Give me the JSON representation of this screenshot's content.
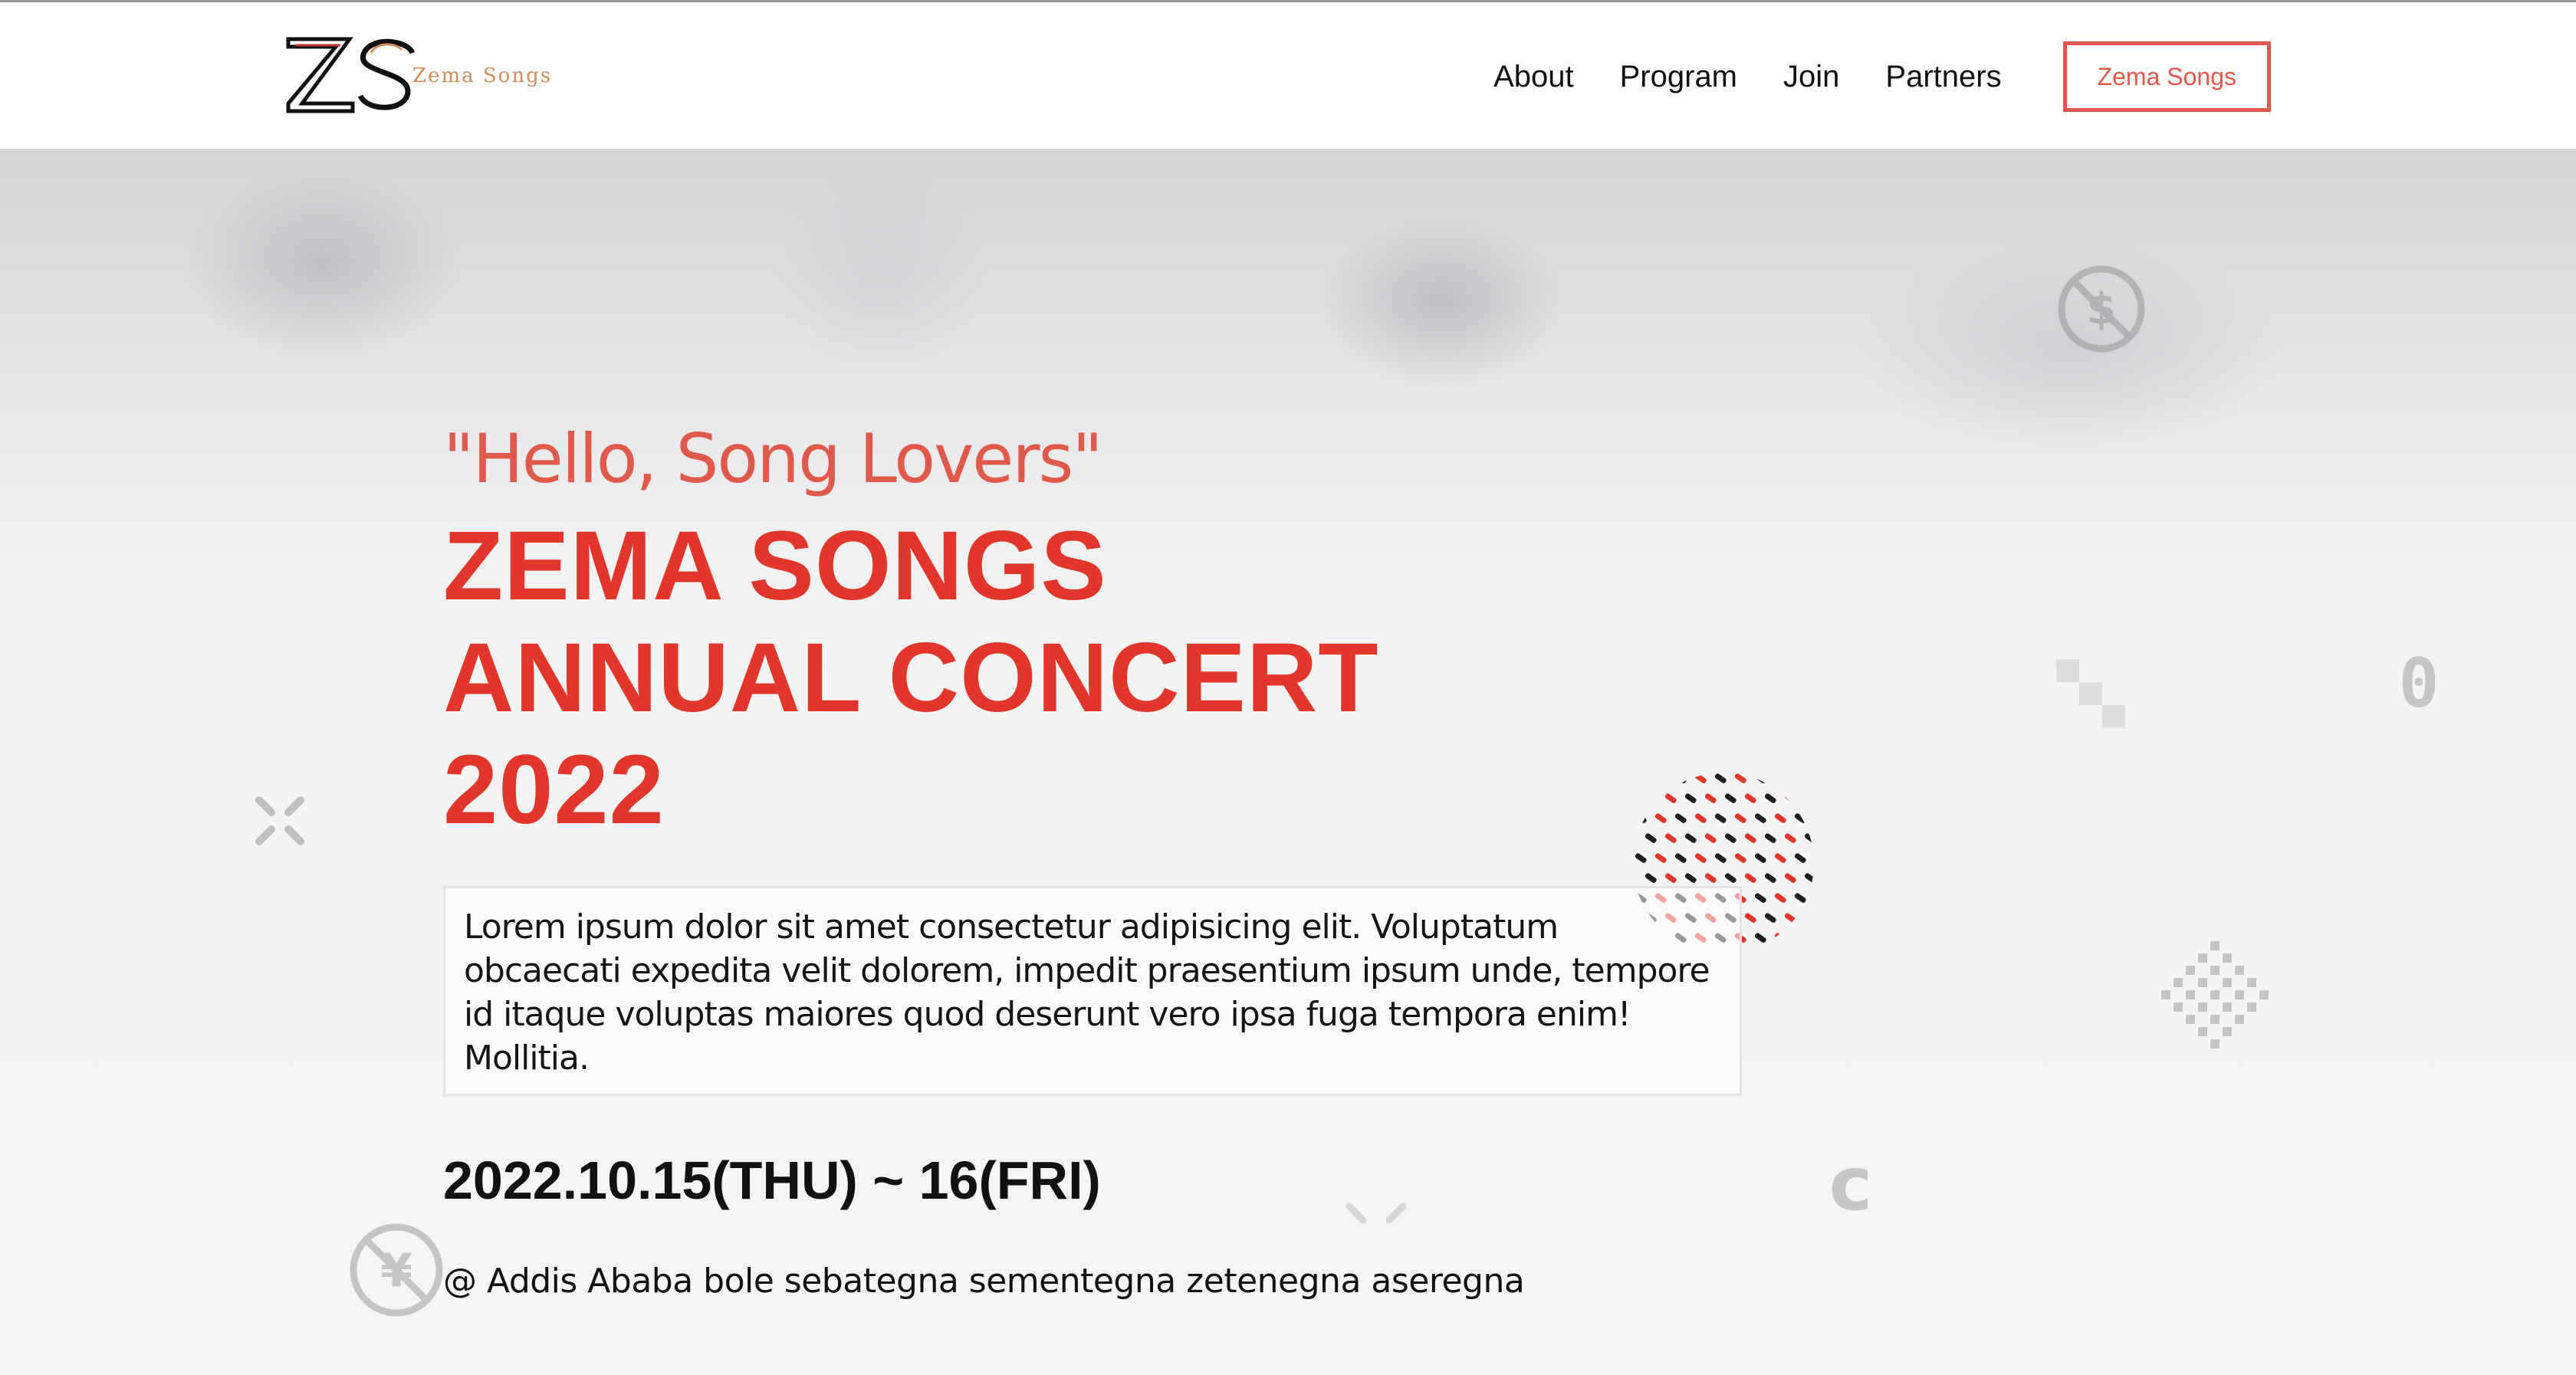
{
  "header": {
    "logo_text": "Zema Songs",
    "nav": [
      "About",
      "Program",
      "Join",
      "Partners"
    ],
    "cta_label": "Zema Songs"
  },
  "hero": {
    "greeting": "\"Hello, Song Lovers\"",
    "title_lines": [
      "ZEMA SONGS",
      "ANNUAL CONCERT",
      "2022"
    ],
    "description": "Lorem ipsum dolor sit amet consectetur adipisicing elit. Voluptatum obcaecati expedita velit dolorem, impedit praesentium ipsum unde, tempore id itaque voluptas maiores quod deserunt vero ipsa fuga tempora enim! Mollitia.",
    "date": "2022.10.15(THU) ~ 16(FRI)",
    "venue": "@ Addis Ababa bole sebategna sementegna zetenegna aseregna"
  },
  "colors": {
    "accent": "#e3362a",
    "accent_soft": "#e0594a",
    "logo_secondary": "#d28c5a"
  },
  "icons": [
    "no-dollar-icon",
    "yen-coin-icon",
    "close-x-icon",
    "zero-glyph-icon",
    "cent-glyph-icon",
    "pixel-diamond-icon",
    "dot-pattern-circle-icon"
  ]
}
